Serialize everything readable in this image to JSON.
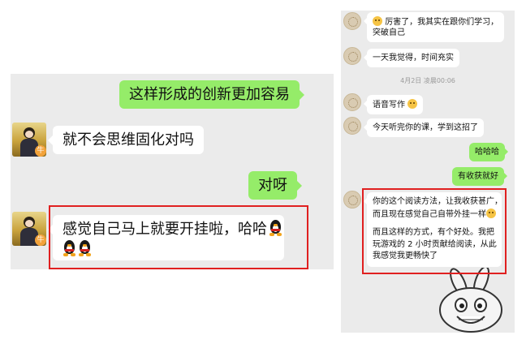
{
  "left_chat": {
    "messages": [
      {
        "side": "out",
        "text": "这样形成的创新更加容易"
      },
      {
        "side": "in",
        "text": "就不会思维固化对吗"
      },
      {
        "side": "out",
        "text": "对呀"
      },
      {
        "side": "in",
        "line1": "感觉自己马上就要开挂啦，哈哈",
        "emoji": [
          "penguin-icon",
          "penguin-icon",
          "penguin-icon"
        ]
      }
    ],
    "avatar_badge": "牛"
  },
  "right_chat": {
    "timestamp": "4月2日 凌晨00:06",
    "messages": [
      {
        "side": "in",
        "line1": "厉害了，我其实在跟你们学习，",
        "line2": "突破自己",
        "emoji": "grin-emoji"
      },
      {
        "side": "in",
        "text": "一天我觉得，时间充实"
      },
      {
        "side": "in",
        "text": "语音写作",
        "emoji": "thinking-emoji"
      },
      {
        "side": "in",
        "text": "今天听完你的课，学到这招了"
      },
      {
        "side": "out",
        "text": "哈哈哈"
      },
      {
        "side": "out",
        "text": "有收获就好"
      },
      {
        "side": "in",
        "line1": "你的这个阅读方法，让我收获甚广，",
        "line2": "而且现在感觉自己自带外挂一样",
        "emoji": "laugh-emoji",
        "line3": "而且这样的方式，有个好处。我把",
        "line4": "玩游戏的 2 小时贡献给阅读，从此",
        "line5": "我感觉我更畅快了"
      }
    ]
  },
  "colors": {
    "outgoing_bubble": "#95ec69",
    "incoming_bubble": "#ffffff",
    "chat_background": "#ebebeb",
    "highlight_border": "#e02020"
  },
  "sticker": "rabbit-sticker"
}
